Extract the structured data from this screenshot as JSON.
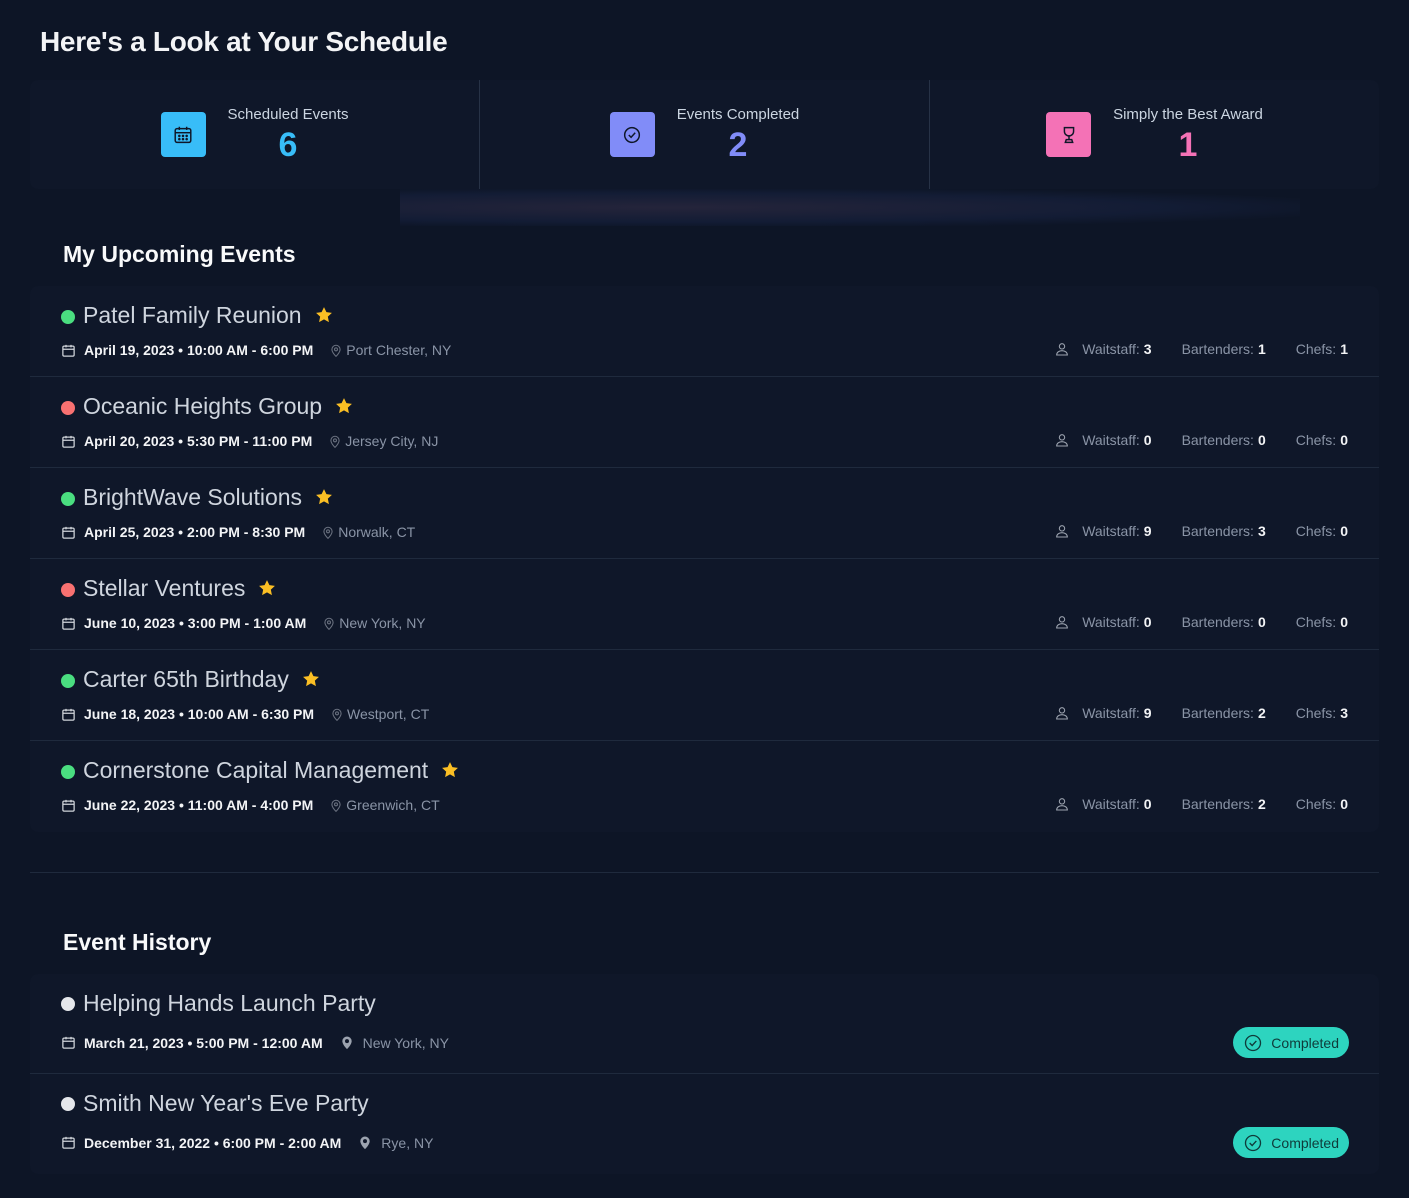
{
  "page": {
    "title": "Here's a Look at Your Schedule"
  },
  "colors": {
    "accent_blue": "#38bdf8",
    "accent_purple": "#818cf8",
    "accent_pink": "#f472b6",
    "status_green": "#4ade80",
    "status_red": "#f87171",
    "status_gray": "#e5e7eb",
    "star": "#fbbf24",
    "completed_badge": "#2dd4bf"
  },
  "stats": [
    {
      "label": "Scheduled Events",
      "value": "6",
      "icon": "calendar-icon",
      "color": "#38bdf8"
    },
    {
      "label": "Events Completed",
      "value": "2",
      "icon": "check-circle-icon",
      "color": "#818cf8"
    },
    {
      "label": "Simply the Best Award",
      "value": "1",
      "icon": "trophy-icon",
      "color": "#f472b6"
    }
  ],
  "upcoming": {
    "title": "My Upcoming Events",
    "staff_labels": {
      "waitstaff": "Waitstaff:",
      "bartenders": "Bartenders:",
      "chefs": "Chefs:"
    },
    "events": [
      {
        "name": "Patel Family Reunion",
        "status": "green",
        "date": "April 19, 2023 • 10:00 AM - 6:00 PM",
        "location": "Port Chester, NY",
        "waitstaff": "3",
        "bartenders": "1",
        "chefs": "1"
      },
      {
        "name": "Oceanic Heights Group",
        "status": "red",
        "date": "April 20, 2023 • 5:30 PM - 11:00 PM",
        "location": "Jersey City, NJ",
        "waitstaff": "0",
        "bartenders": "0",
        "chefs": "0"
      },
      {
        "name": "BrightWave Solutions",
        "status": "green",
        "date": "April 25, 2023 • 2:00 PM - 8:30 PM",
        "location": "Norwalk, CT",
        "waitstaff": "9",
        "bartenders": "3",
        "chefs": "0"
      },
      {
        "name": "Stellar Ventures",
        "status": "red",
        "date": "June 10, 2023 • 3:00 PM - 1:00 AM",
        "location": "New York, NY",
        "waitstaff": "0",
        "bartenders": "0",
        "chefs": "0"
      },
      {
        "name": "Carter 65th Birthday",
        "status": "green",
        "date": "June 18, 2023 • 10:00 AM - 6:30 PM",
        "location": "Westport, CT",
        "waitstaff": "9",
        "bartenders": "2",
        "chefs": "3"
      },
      {
        "name": "Cornerstone Capital Management",
        "status": "green",
        "date": "June 22, 2023 • 11:00 AM - 4:00 PM",
        "location": "Greenwich, CT",
        "waitstaff": "0",
        "bartenders": "2",
        "chefs": "0"
      }
    ]
  },
  "history": {
    "title": "Event History",
    "events": [
      {
        "name": "Helping Hands Launch Party",
        "date": "March 21, 2023 • 5:00 PM - 12:00 AM",
        "location": "New York, NY",
        "badge": "Completed"
      },
      {
        "name": "Smith New Year's Eve Party",
        "date": "December 31, 2022 • 6:00 PM - 2:00 AM",
        "location": "Rye, NY",
        "badge": "Completed"
      }
    ]
  }
}
